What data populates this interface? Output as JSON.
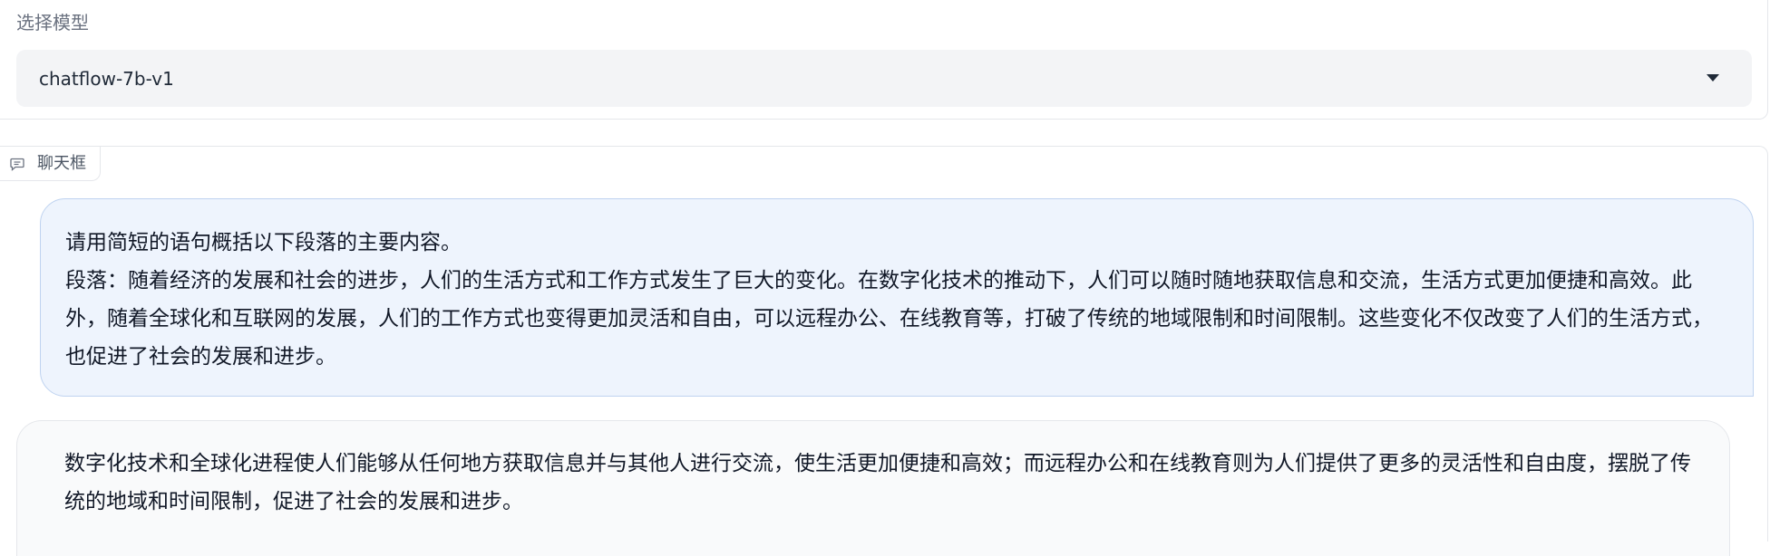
{
  "model_selector": {
    "label": "选择模型",
    "selected": "chatflow-7b-v1",
    "caret_icon": "caret-down-icon"
  },
  "chat": {
    "tag_label": "聊天框",
    "tag_icon": "chat-bubble-icon",
    "messages": [
      {
        "role": "user",
        "lines": [
          "请用简短的语句概括以下段落的主要内容。",
          "段落：随着经济的发展和社会的进步，人们的生活方式和工作方式发生了巨大的变化。在数字化技术的推动下，人们可以随时随地获取信息和交流，生活方式更加便捷和高效。此外，随着全球化和互联网的发展，人们的工作方式也变得更加灵活和自由，可以远程办公、在线教育等，打破了传统的地域限制和时间限制。这些变化不仅改变了人们的生活方式，也促进了社会的发展和进步。"
        ]
      },
      {
        "role": "assistant",
        "lines": [
          "数字化技术和全球化进程使人们能够从任何地方获取信息并与其他人进行交流，使生活更加便捷和高效；而远程办公和在线教育则为人们提供了更多的灵活性和自由度，摆脱了传统的地域和时间限制，促进了社会的发展和进步。"
        ]
      }
    ]
  },
  "colors": {
    "user_bubble_bg": "#eef4fd",
    "user_bubble_border": "#bfd3f0",
    "bot_bubble_bg": "#f9fafb",
    "select_bg": "#f3f4f6"
  }
}
